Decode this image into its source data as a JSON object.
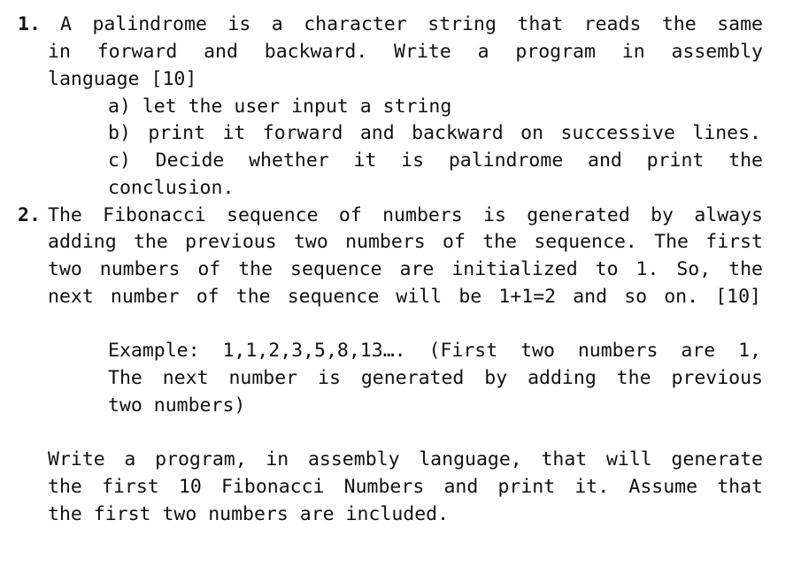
{
  "q1": {
    "number": "1.",
    "lines": [
      "A palindrome is a character string that reads the same",
      "in forward and backward. Write a program in assembly",
      "language [10]"
    ],
    "subitems": [
      "a) let the user input a string",
      "b) print it forward and backward on successive lines.",
      "c) Decide whether it is palindrome and print the",
      "conclusion."
    ]
  },
  "q2": {
    "number": "2.",
    "lines": [
      "The Fibonacci sequence of numbers is generated by always",
      "adding the previous two numbers of the sequence. The first",
      "two numbers of the sequence are initialized to 1. So, the",
      "next number of the sequence will be 1+1=2 and so on. [10]"
    ],
    "example_lines": [
      "Example: 1,1,2,3,5,8,13…. (First two numbers are 1,",
      "The next number is generated by adding the previous",
      "two numbers)"
    ],
    "task_lines": [
      "Write a program, in assembly language, that will generate",
      "the first 10 Fibonacci Numbers and print it. Assume that",
      "the first two numbers are included."
    ]
  }
}
